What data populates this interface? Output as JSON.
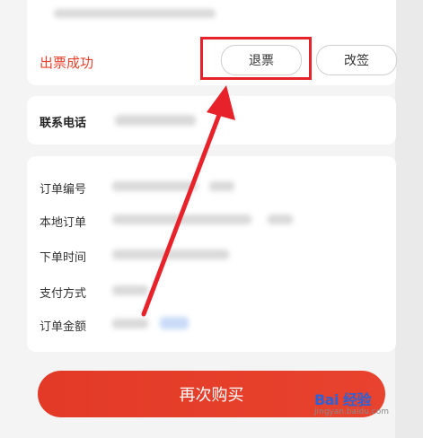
{
  "order": {
    "status_text": "出票成功",
    "refund_label": "退票",
    "change_label": "改签",
    "phone_label": "联系电话",
    "fields": [
      {
        "label": "订单编号"
      },
      {
        "label": "本地订单"
      },
      {
        "label": "下单时间"
      },
      {
        "label": "支付方式"
      },
      {
        "label": "订单金额"
      }
    ],
    "rebuy_label": "再次购买"
  },
  "watermark": {
    "brand": "Bai 经验",
    "sub": "jingyan.baidu.com"
  },
  "colors": {
    "accent": "#e8432e",
    "annotation": "#e8222a",
    "watermark": "#2d62d6"
  }
}
